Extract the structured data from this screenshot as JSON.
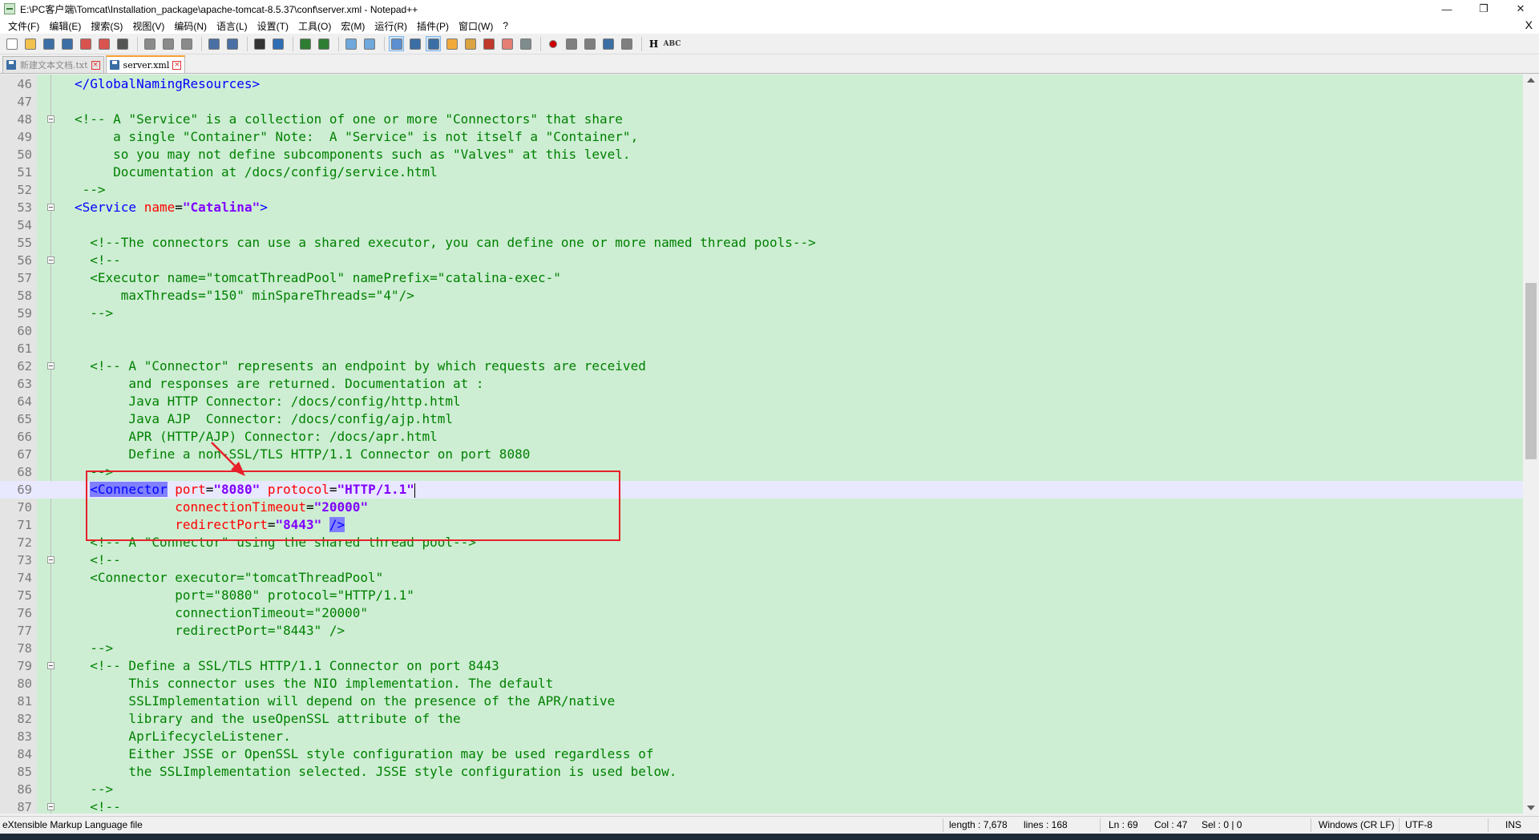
{
  "window": {
    "title": "E:\\PC客户端\\Tomcat\\Installation_package\\apache-tomcat-8.5.37\\conf\\server.xml - Notepad++",
    "minimize": "—",
    "restore": "❐",
    "close": "✕"
  },
  "menu": {
    "items": [
      "文件(F)",
      "编辑(E)",
      "搜索(S)",
      "视图(V)",
      "编码(N)",
      "语言(L)",
      "设置(T)",
      "工具(O)",
      "宏(M)",
      "运行(R)",
      "插件(P)",
      "窗口(W)",
      "?"
    ],
    "close_doc": "X"
  },
  "toolbar": {
    "icons": [
      "new-file-icon",
      "open-file-icon",
      "save-icon",
      "save-all-icon",
      "close-icon",
      "close-all-icon",
      "print-icon",
      "cut-icon",
      "copy-icon",
      "paste-icon",
      "undo-icon",
      "redo-icon",
      "find-icon",
      "replace-icon",
      "zoom-in-icon",
      "zoom-out-icon",
      "sync-v-icon",
      "sync-h-icon",
      "word-wrap-icon",
      "show-all-chars-icon",
      "indent-guide-icon",
      "udl-icon",
      "doc-map-icon",
      "function-list-icon",
      "folder-workspace-icon",
      "monitoring-icon",
      "record-macro-icon",
      "stop-macro-icon",
      "play-macro-icon",
      "run-macro-multiple-icon",
      "save-macro-icon",
      "hex-icon",
      "spellcheck-icon"
    ],
    "hex_label": "H",
    "spell_label": "ABC"
  },
  "tabs": [
    {
      "label": "新建文本文档.txt",
      "active": false
    },
    {
      "label": "server.xml",
      "active": true
    }
  ],
  "editor": {
    "current_line": 69,
    "lines": [
      {
        "n": 46,
        "fold": false,
        "segs": [
          [
            "tag",
            "</GlobalNamingResources>"
          ]
        ],
        "indent": 0
      },
      {
        "n": 47,
        "fold": false,
        "segs": [],
        "indent": 0
      },
      {
        "n": 48,
        "fold": true,
        "segs": [
          [
            "comment",
            "<!-- A \"Service\" is a collection of one or more \"Connectors\" that share"
          ]
        ],
        "indent": 0
      },
      {
        "n": 49,
        "fold": false,
        "segs": [
          [
            "comment",
            "     a single \"Container\" Note:  A \"Service\" is not itself a \"Container\","
          ]
        ],
        "indent": 0
      },
      {
        "n": 50,
        "fold": false,
        "segs": [
          [
            "comment",
            "     so you may not define subcomponents such as \"Valves\" at this level."
          ]
        ],
        "indent": 0
      },
      {
        "n": 51,
        "fold": false,
        "segs": [
          [
            "comment",
            "     Documentation at /docs/config/service.html"
          ]
        ],
        "indent": 0
      },
      {
        "n": 52,
        "fold": false,
        "segs": [
          [
            "comment",
            " -->"
          ]
        ],
        "indent": 0
      },
      {
        "n": 53,
        "fold": true,
        "segs": [
          [
            "tag",
            "<Service "
          ],
          [
            "attr",
            "name"
          ],
          [
            "txt",
            "="
          ],
          [
            "val",
            "\"Catalina\""
          ],
          [
            "tag",
            ">"
          ]
        ],
        "indent": 0
      },
      {
        "n": 54,
        "fold": false,
        "segs": [],
        "indent": 0
      },
      {
        "n": 55,
        "fold": false,
        "segs": [
          [
            "comment",
            "  <!--The connectors can use a shared executor, you can define one or more named thread pools-->"
          ]
        ],
        "indent": 0
      },
      {
        "n": 56,
        "fold": true,
        "segs": [
          [
            "comment",
            "  <!--"
          ]
        ],
        "indent": 0
      },
      {
        "n": 57,
        "fold": false,
        "segs": [
          [
            "comment",
            "  <Executor name=\"tomcatThreadPool\" namePrefix=\"catalina-exec-\""
          ]
        ],
        "indent": 0
      },
      {
        "n": 58,
        "fold": false,
        "segs": [
          [
            "comment",
            "      maxThreads=\"150\" minSpareThreads=\"4\"/>"
          ]
        ],
        "indent": 0
      },
      {
        "n": 59,
        "fold": false,
        "segs": [
          [
            "comment",
            "  -->"
          ]
        ],
        "indent": 0
      },
      {
        "n": 60,
        "fold": false,
        "segs": [],
        "indent": 0
      },
      {
        "n": 61,
        "fold": false,
        "segs": [],
        "indent": 0
      },
      {
        "n": 62,
        "fold": true,
        "segs": [
          [
            "comment",
            "  <!-- A \"Connector\" represents an endpoint by which requests are received"
          ]
        ],
        "indent": 0
      },
      {
        "n": 63,
        "fold": false,
        "segs": [
          [
            "comment",
            "       and responses are returned. Documentation at :"
          ]
        ],
        "indent": 0
      },
      {
        "n": 64,
        "fold": false,
        "segs": [
          [
            "comment",
            "       Java HTTP Connector: /docs/config/http.html"
          ]
        ],
        "indent": 0
      },
      {
        "n": 65,
        "fold": false,
        "segs": [
          [
            "comment",
            "       Java AJP  Connector: /docs/config/ajp.html"
          ]
        ],
        "indent": 0
      },
      {
        "n": 66,
        "fold": false,
        "segs": [
          [
            "comment",
            "       APR (HTTP/AJP) Connector: /docs/apr.html"
          ]
        ],
        "indent": 0
      },
      {
        "n": 67,
        "fold": false,
        "segs": [
          [
            "comment",
            "       Define a non-SSL/TLS HTTP/1.1 Connector on port 8080"
          ]
        ],
        "indent": 0
      },
      {
        "n": 68,
        "fold": false,
        "segs": [
          [
            "comment",
            "  -->"
          ]
        ],
        "indent": 0
      },
      {
        "n": 69,
        "fold": false,
        "segs": [
          [
            "txt",
            "  "
          ],
          [
            "hltag",
            "<Connector"
          ],
          [
            "txt",
            " "
          ],
          [
            "attr",
            "port"
          ],
          [
            "txt",
            "="
          ],
          [
            "val",
            "\"8080\""
          ],
          [
            "txt",
            " "
          ],
          [
            "attr",
            "protocol"
          ],
          [
            "txt",
            "="
          ],
          [
            "val",
            "\"HTTP/1.1\""
          ],
          [
            "caret",
            ""
          ]
        ],
        "indent": 0
      },
      {
        "n": 70,
        "fold": false,
        "segs": [
          [
            "txt",
            "             "
          ],
          [
            "attr",
            "connectionTimeout"
          ],
          [
            "txt",
            "="
          ],
          [
            "val",
            "\"20000\""
          ]
        ],
        "indent": 0
      },
      {
        "n": 71,
        "fold": false,
        "segs": [
          [
            "txt",
            "             "
          ],
          [
            "attr",
            "redirectPort"
          ],
          [
            "txt",
            "="
          ],
          [
            "val",
            "\"8443\""
          ],
          [
            "txt",
            " "
          ],
          [
            "hltag",
            "/>"
          ]
        ],
        "indent": 0
      },
      {
        "n": 72,
        "fold": false,
        "segs": [
          [
            "comment",
            "  <!-- A \"Connector\" using the shared thread pool-->"
          ]
        ],
        "indent": 0
      },
      {
        "n": 73,
        "fold": true,
        "segs": [
          [
            "comment",
            "  <!--"
          ]
        ],
        "indent": 0
      },
      {
        "n": 74,
        "fold": false,
        "segs": [
          [
            "comment",
            "  <Connector executor=\"tomcatThreadPool\""
          ]
        ],
        "indent": 0
      },
      {
        "n": 75,
        "fold": false,
        "segs": [
          [
            "comment",
            "             port=\"8080\" protocol=\"HTTP/1.1\""
          ]
        ],
        "indent": 0
      },
      {
        "n": 76,
        "fold": false,
        "segs": [
          [
            "comment",
            "             connectionTimeout=\"20000\""
          ]
        ],
        "indent": 0
      },
      {
        "n": 77,
        "fold": false,
        "segs": [
          [
            "comment",
            "             redirectPort=\"8443\" />"
          ]
        ],
        "indent": 0
      },
      {
        "n": 78,
        "fold": false,
        "segs": [
          [
            "comment",
            "  -->"
          ]
        ],
        "indent": 0
      },
      {
        "n": 79,
        "fold": true,
        "segs": [
          [
            "comment",
            "  <!-- Define a SSL/TLS HTTP/1.1 Connector on port 8443"
          ]
        ],
        "indent": 0
      },
      {
        "n": 80,
        "fold": false,
        "segs": [
          [
            "comment",
            "       This connector uses the NIO implementation. The default"
          ]
        ],
        "indent": 0
      },
      {
        "n": 81,
        "fold": false,
        "segs": [
          [
            "comment",
            "       SSLImplementation will depend on the presence of the APR/native"
          ]
        ],
        "indent": 0
      },
      {
        "n": 82,
        "fold": false,
        "segs": [
          [
            "comment",
            "       library and the useOpenSSL attribute of the"
          ]
        ],
        "indent": 0
      },
      {
        "n": 83,
        "fold": false,
        "segs": [
          [
            "comment",
            "       AprLifecycleListener."
          ]
        ],
        "indent": 0
      },
      {
        "n": 84,
        "fold": false,
        "segs": [
          [
            "comment",
            "       Either JSSE or OpenSSL style configuration may be used regardless of"
          ]
        ],
        "indent": 0
      },
      {
        "n": 85,
        "fold": false,
        "segs": [
          [
            "comment",
            "       the SSLImplementation selected. JSSE style configuration is used below."
          ]
        ],
        "indent": 0
      },
      {
        "n": 86,
        "fold": false,
        "segs": [
          [
            "comment",
            "  -->"
          ]
        ],
        "indent": 0
      },
      {
        "n": 87,
        "fold": true,
        "segs": [
          [
            "comment",
            "  <!--"
          ]
        ],
        "indent": 0
      }
    ]
  },
  "status": {
    "file_type": "eXtensible Markup Language file",
    "length": "length : 7,678",
    "lines": "lines : 168",
    "ln": "Ln : 69",
    "col": "Col : 47",
    "sel": "Sel : 0 | 0",
    "eol": "Windows (CR LF)",
    "encoding": "UTF-8",
    "mode": "INS"
  },
  "colors": {
    "editor_bg": "#cdeed3",
    "current_line_bg": "#e8e8ff",
    "annotation_red": "#e8202a"
  }
}
